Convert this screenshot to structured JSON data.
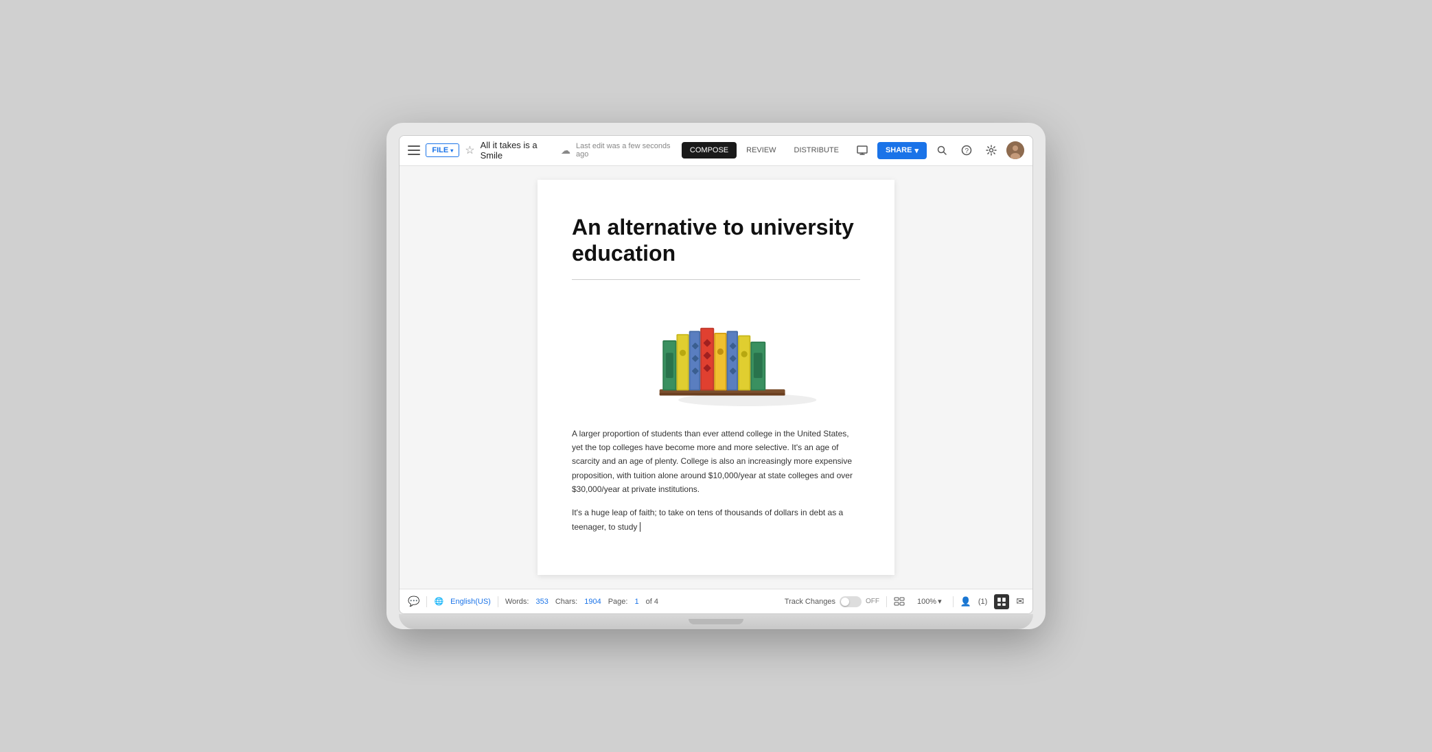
{
  "toolbar": {
    "file_label": "FILE",
    "file_chevron": "▾",
    "doc_title": "All it takes is a Smile",
    "last_edit": "Last edit was a few seconds ago",
    "tabs": [
      {
        "id": "compose",
        "label": "COMPOSE",
        "active": true
      },
      {
        "id": "review",
        "label": "REVIEW",
        "active": false
      },
      {
        "id": "distribute",
        "label": "DISTRIBUTE",
        "active": false
      }
    ],
    "share_label": "SHARE",
    "share_chevron": "▾"
  },
  "document": {
    "heading": "An alternative to university education",
    "body_para1": "A larger proportion of students than ever attend college in the United States, yet the top colleges have become more and more selective. It's an age of scarcity and an age of plenty. College is also an increasingly more expensive proposition, with tuition alone around $10,000/year at state colleges and over $30,000/year at private institutions.",
    "body_para2": "It's a huge leap of faith; to take on tens of thousands of dollars in debt as a teenager, to study"
  },
  "status_bar": {
    "words_label": "Words:",
    "words_count": "353",
    "chars_label": "Chars:",
    "chars_count": "1904",
    "page_label": "Page:",
    "page_current": "1",
    "page_of": "of 4",
    "language": "English(US)",
    "track_changes_label": "Track Changes",
    "toggle_state": "OFF",
    "zoom_level": "100%",
    "collab_count": "(1)"
  },
  "icons": {
    "hamburger": "☰",
    "star": "☆",
    "cloud": "☁",
    "search": "🔍",
    "help": "?",
    "settings": "⚙",
    "comment": "💬",
    "lang": "🌐",
    "mail": "✉",
    "grid": "▦",
    "chevron_down": "▾"
  },
  "colors": {
    "accent": "#1a73e8",
    "active_tab_bg": "#1a1a1a",
    "active_tab_text": "#ffffff"
  }
}
